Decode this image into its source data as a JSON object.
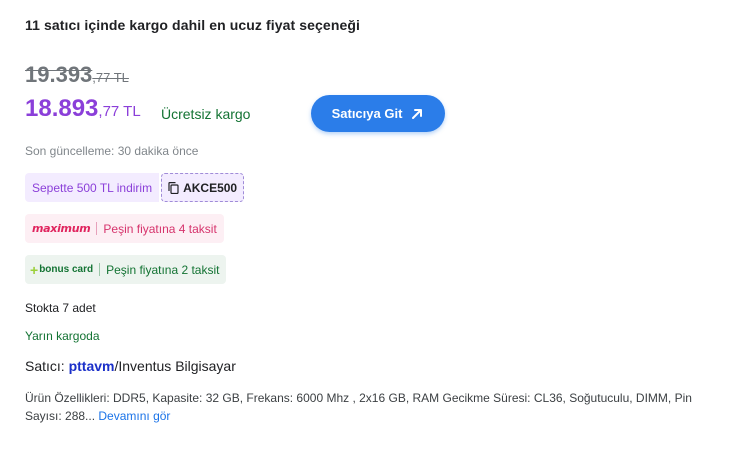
{
  "header": {
    "title": "11 satıcı içinde kargo dahil en ucuz fiyat seçeneği"
  },
  "price": {
    "old_int": "19.393",
    "old_dec": ",77 TL",
    "new_int": "18.893",
    "new_dec": ",77 TL",
    "shipping": "Ücretsiz kargo"
  },
  "go_button": {
    "label": "Satıcıya Git",
    "icon": "arrow-up-right-icon"
  },
  "updated": "Son güncelleme: 30 dakika önce",
  "coupon": {
    "text": "Sepette 500 TL indirim",
    "code": "AKCE500",
    "icon": "copy-icon"
  },
  "maximum": {
    "logo": "maximum",
    "text": "Peşin fiyatına 4 taksit"
  },
  "bonus": {
    "logo": "bonus card",
    "text": "Peşin fiyatına 2 taksit"
  },
  "stock": "Stokta 7 adet",
  "delivery": "Yarın kargoda",
  "seller": {
    "prefix": "Satıcı:",
    "logo": "pttavm",
    "name": "/Inventus Bilgisayar"
  },
  "features": {
    "text": "Ürün Özellikleri: DDR5, Kapasite: 32 GB, Frekans: 6000 Mhz , 2x16 GB, RAM Gecikme Süresi: CL36, Soğutuculu, DIMM, Pin Sayısı: 288...",
    "more": "Devamını gör"
  },
  "colors": {
    "accent_purple": "#8b3fd9",
    "button_blue": "#2b7de9",
    "green": "#137333",
    "maximum_pink": "#e0245e"
  }
}
